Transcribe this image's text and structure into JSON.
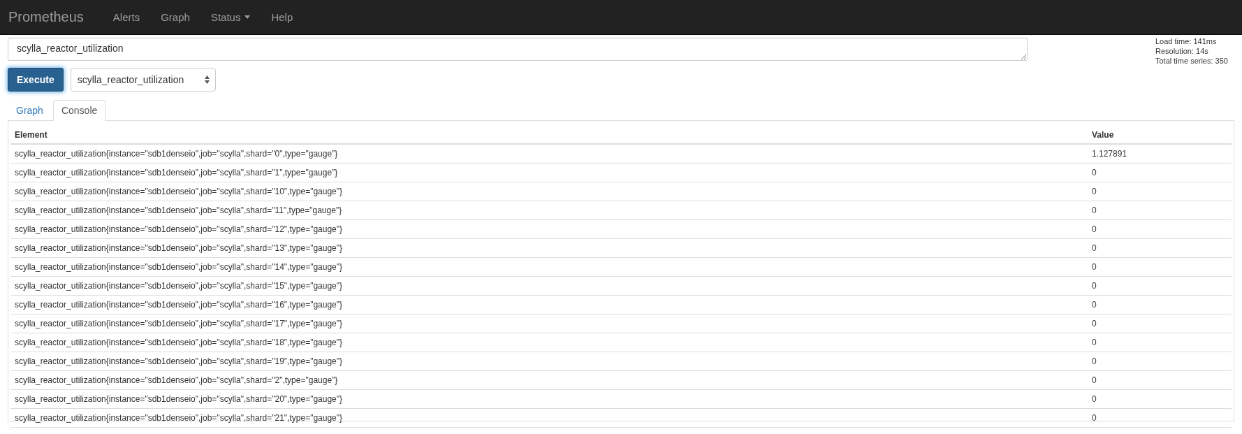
{
  "navbar": {
    "brand": "Prometheus",
    "links": [
      {
        "label": "Alerts",
        "kind": "link"
      },
      {
        "label": "Graph",
        "kind": "link"
      },
      {
        "label": "Status",
        "kind": "dropdown"
      },
      {
        "label": "Help",
        "kind": "link"
      }
    ]
  },
  "query": {
    "expression": "scylla_reactor_utilization",
    "execute_button": "Execute",
    "metric_select": "scylla_reactor_utilization"
  },
  "stats": [
    "Load time: 141ms",
    "Resolution: 14s",
    "Total time series: 350"
  ],
  "tabs": [
    {
      "label": "Graph",
      "selected": false
    },
    {
      "label": "Console",
      "selected": true
    }
  ],
  "table": {
    "columns": [
      "Element",
      "Value"
    ],
    "rows": [
      [
        "scylla_reactor_utilization{instance=\"sdb1denseio\",job=\"scylla\",shard=\"0\",type=\"gauge\"}",
        "1.127891"
      ],
      [
        "scylla_reactor_utilization{instance=\"sdb1denseio\",job=\"scylla\",shard=\"1\",type=\"gauge\"}",
        "0"
      ],
      [
        "scylla_reactor_utilization{instance=\"sdb1denseio\",job=\"scylla\",shard=\"10\",type=\"gauge\"}",
        "0"
      ],
      [
        "scylla_reactor_utilization{instance=\"sdb1denseio\",job=\"scylla\",shard=\"11\",type=\"gauge\"}",
        "0"
      ],
      [
        "scylla_reactor_utilization{instance=\"sdb1denseio\",job=\"scylla\",shard=\"12\",type=\"gauge\"}",
        "0"
      ],
      [
        "scylla_reactor_utilization{instance=\"sdb1denseio\",job=\"scylla\",shard=\"13\",type=\"gauge\"}",
        "0"
      ],
      [
        "scylla_reactor_utilization{instance=\"sdb1denseio\",job=\"scylla\",shard=\"14\",type=\"gauge\"}",
        "0"
      ],
      [
        "scylla_reactor_utilization{instance=\"sdb1denseio\",job=\"scylla\",shard=\"15\",type=\"gauge\"}",
        "0"
      ],
      [
        "scylla_reactor_utilization{instance=\"sdb1denseio\",job=\"scylla\",shard=\"16\",type=\"gauge\"}",
        "0"
      ],
      [
        "scylla_reactor_utilization{instance=\"sdb1denseio\",job=\"scylla\",shard=\"17\",type=\"gauge\"}",
        "0"
      ],
      [
        "scylla_reactor_utilization{instance=\"sdb1denseio\",job=\"scylla\",shard=\"18\",type=\"gauge\"}",
        "0"
      ],
      [
        "scylla_reactor_utilization{instance=\"sdb1denseio\",job=\"scylla\",shard=\"19\",type=\"gauge\"}",
        "0"
      ],
      [
        "scylla_reactor_utilization{instance=\"sdb1denseio\",job=\"scylla\",shard=\"2\",type=\"gauge\"}",
        "0"
      ],
      [
        "scylla_reactor_utilization{instance=\"sdb1denseio\",job=\"scylla\",shard=\"20\",type=\"gauge\"}",
        "0"
      ],
      [
        "scylla_reactor_utilization{instance=\"sdb1denseio\",job=\"scylla\",shard=\"21\",type=\"gauge\"}",
        "0"
      ]
    ]
  }
}
